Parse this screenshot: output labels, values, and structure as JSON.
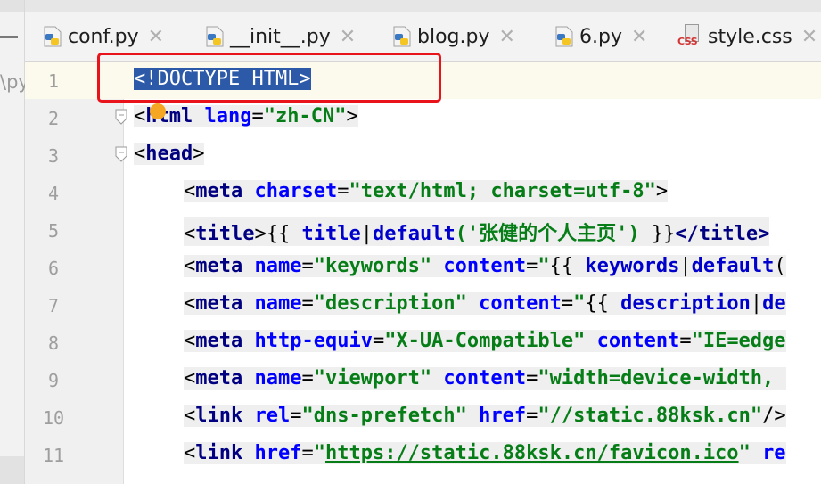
{
  "project_panel": {
    "path_fragment": "\\py"
  },
  "tabs": [
    {
      "label": "conf.py",
      "icon": "python-file-icon"
    },
    {
      "label": "__init__.py",
      "icon": "python-file-icon"
    },
    {
      "label": "blog.py",
      "icon": "python-file-icon"
    },
    {
      "label": "6.py",
      "icon": "python-file-icon"
    },
    {
      "label": "style.css",
      "icon": "css-file-icon",
      "badge": "CSS"
    }
  ],
  "tab_close_symbol": "✕",
  "editor": {
    "line_numbers": [
      "1",
      "2",
      "3",
      "4",
      "5",
      "6",
      "7",
      "8",
      "9",
      "10",
      "11"
    ],
    "lines": {
      "l1": {
        "text": "<!DOCTYPE HTML>"
      },
      "l2": {
        "open": "<",
        "tag": "html",
        "sp": " ",
        "attr": "lang",
        "eq": "=",
        "val": "\"zh-CN\"",
        "close": ">"
      },
      "l3": {
        "open": "<",
        "tag": "head",
        "close": ">"
      },
      "l4": {
        "open": "<",
        "tag": "meta",
        "sp": " ",
        "attr": "charset",
        "eq": "=",
        "val": "\"text/html; charset=utf-8\"",
        "close": ">"
      },
      "l5": {
        "open": "<",
        "tag": "title",
        "close": ">",
        "t1": "{{ ",
        "var": "title",
        "pipe": "|",
        "filter": "default",
        "arg": "('张健的个人主页')",
        "t2": " }}",
        "endtag": "</title>"
      },
      "l6": {
        "open": "<",
        "tag": "meta",
        "sp": " ",
        "attr1": "name",
        "eq1": "=",
        "val1": "\"keywords\"",
        "sp2": " ",
        "attr2": "content",
        "eq2": "=",
        "q": "\"",
        "t1": "{{ ",
        "var": "keywords",
        "pipe": "|",
        "filter": "default",
        "rest": "("
      },
      "l7": {
        "open": "<",
        "tag": "meta",
        "sp": " ",
        "attr1": "name",
        "eq1": "=",
        "val1": "\"description\"",
        "sp2": " ",
        "attr2": "content",
        "eq2": "=",
        "q": "\"",
        "t1": "{{ ",
        "var": "description",
        "pipe": "|",
        "filter": "de"
      },
      "l8": {
        "open": "<",
        "tag": "meta",
        "sp": " ",
        "attr1": "http-equiv",
        "eq1": "=",
        "val1": "\"X-UA-Compatible\"",
        "sp2": " ",
        "attr2": "content",
        "eq2": "=",
        "val2": "\"IE=edge"
      },
      "l9": {
        "open": "<",
        "tag": "meta",
        "sp": " ",
        "attr1": "name",
        "eq1": "=",
        "val1": "\"viewport\"",
        "sp2": " ",
        "attr2": "content",
        "eq2": "=",
        "val2": "\"width=device-width, "
      },
      "l10": {
        "open": "<",
        "tag": "link",
        "sp": " ",
        "attr1": "rel",
        "eq1": "=",
        "val1": "\"dns-prefetch\"",
        "sp2": " ",
        "attr2": "href",
        "eq2": "=",
        "val2": "\"//static.88ksk.cn\"",
        "close": "/>"
      },
      "l11": {
        "open": "<",
        "tag": "link",
        "sp": " ",
        "attr1": "href",
        "eq1": "=",
        "q": "\"",
        "url": "https://static.88ksk.cn/favicon.ico",
        "q2": "\"",
        "sp2": " ",
        "attr2": "re"
      }
    }
  },
  "colors": {
    "tag": "#000080",
    "attribute": "#0000ff",
    "string": "#067d17",
    "selection": "#2d5aa8",
    "annotation_box": "#e8131b",
    "current_line": "#fcfaed"
  }
}
